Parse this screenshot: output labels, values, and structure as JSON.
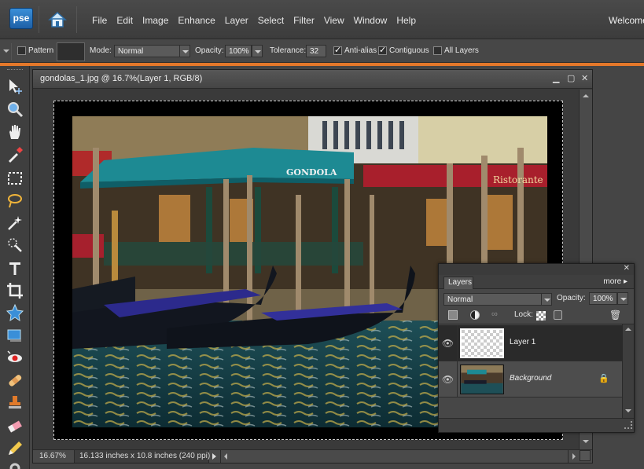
{
  "app": {
    "logo_text": "pse",
    "welcome_text": "Welcome"
  },
  "menu": [
    "File",
    "Edit",
    "Image",
    "Enhance",
    "Layer",
    "Select",
    "Filter",
    "View",
    "Window",
    "Help"
  ],
  "options": {
    "pattern_label": "Pattern",
    "mode_label": "Mode:",
    "mode_value": "Normal",
    "opacity_label": "Opacity:",
    "opacity_value": "100%",
    "tolerance_label": "Tolerance:",
    "tolerance_value": "32",
    "antialias_label": "Anti-alias",
    "antialias_checked": true,
    "contiguous_label": "Contiguous",
    "contiguous_checked": true,
    "alllayers_label": "All Layers",
    "alllayers_checked": false
  },
  "document": {
    "title": "gondolas_1.jpg @ 16.7%(Layer 1, RGB/8)",
    "zoom": "16.67%",
    "dimensions": "16.133 inches x 10.8 inches (240 ppi)",
    "photo": {
      "awning_text": "GONDOLA",
      "sign_text": "Ristorante"
    }
  },
  "layers_panel": {
    "tab_label": "Layers",
    "more_label": "more",
    "blend_mode": "Normal",
    "opacity_label": "Opacity:",
    "opacity_value": "100%",
    "lock_label": "Lock:",
    "layers": [
      {
        "name": "Layer 1",
        "selected": true
      },
      {
        "name": "Background",
        "selected": false,
        "locked": true
      }
    ]
  },
  "colors": {
    "accent": "#e4782a",
    "chrome": "#454545"
  }
}
